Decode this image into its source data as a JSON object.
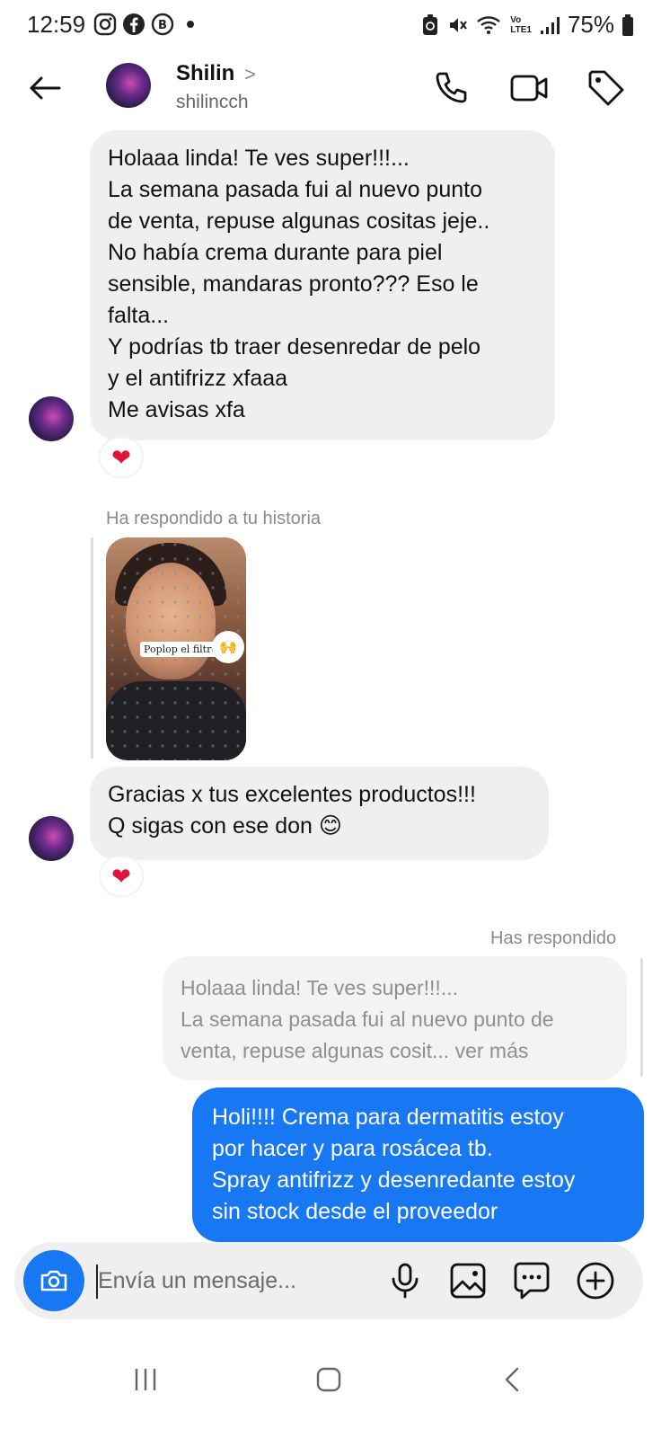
{
  "status": {
    "time": "12:59",
    "battery": "75%",
    "network": "LTE1",
    "volte": "Vo",
    "left_icons": [
      "instagram-icon",
      "facebook-icon",
      "b-badge-icon"
    ],
    "right_icons": [
      "battery-saver-icon",
      "mute-icon",
      "wifi-icon",
      "signal-icon",
      "battery-icon"
    ]
  },
  "header": {
    "name": "Shilin",
    "chevron": ">",
    "username": "shilincch",
    "actions": [
      "phone-icon",
      "video-icon",
      "tag-icon"
    ]
  },
  "thread": {
    "msg1": "Holaaa linda! Te ves super!!!...\nLa semana pasada fui al nuevo punto\nde venta, repuse algunas cositas jeje..\nNo había crema durante para piel\nsensible, mandaras pronto??? Eso le\nfalta...\nY podrías tb traer desenredar de pelo\ny el antifrizz xfaaa\nMe avisas xfa",
    "reaction1": "❤",
    "story_label": "Ha respondido a tu historia",
    "story_caption": "Poplop el filtro 😜",
    "story_sticker": "🙌",
    "msg2": "Gracias x tus excelentes productos!!!\nQ sigas con ese don 😊",
    "reaction2": "❤",
    "reply_label": "Has respondido",
    "reply_quote": "Holaaa linda! Te ves super!!!...\nLa semana pasada fui al nuevo punto de\nventa, repuse algunas cosit... ver más",
    "msg_out": "Holi!!!! Crema para dermatitis estoy\npor hacer y para rosácea tb.\nSpray antifrizz y desenredante estoy\nsin stock desde el proveedor"
  },
  "composer": {
    "placeholder": "Envía un mensaje...",
    "icons": [
      "camera-icon",
      "microphone-icon",
      "gallery-icon",
      "sticker-icon",
      "plus-icon"
    ]
  },
  "navbar": {
    "buttons": [
      "recent-apps-icon",
      "home-icon",
      "back-nav-icon"
    ]
  },
  "colors": {
    "accent": "#1877f2",
    "bubble_in": "#efefef",
    "heart": "#e0133a"
  }
}
